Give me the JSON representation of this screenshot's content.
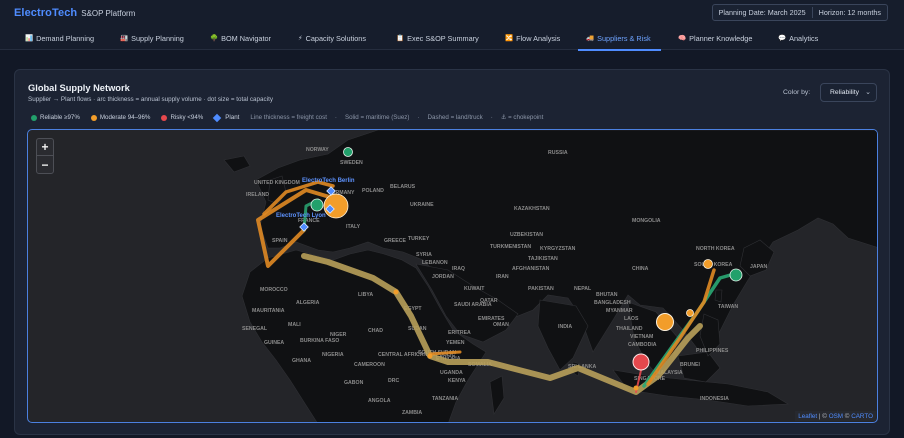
{
  "header": {
    "brand": "ElectroTech",
    "app_name": "S&OP Platform",
    "planning_date": "Planning Date: March 2025",
    "horizon": "Horizon: 12 months"
  },
  "tabs": [
    {
      "label": "Demand Planning",
      "icon": "chart-icon"
    },
    {
      "label": "Supply Planning",
      "icon": "factory-icon"
    },
    {
      "label": "BOM Navigator",
      "icon": "tree-icon"
    },
    {
      "label": "Capacity Solutions",
      "icon": "bolt-icon"
    },
    {
      "label": "Exec S&OP Summary",
      "icon": "clipboard-icon"
    },
    {
      "label": "Flow Analysis",
      "icon": "flow-icon"
    },
    {
      "label": "Suppliers & Risk",
      "icon": "truck-icon",
      "active": true
    },
    {
      "label": "Planner Knowledge",
      "icon": "brain-icon"
    },
    {
      "label": "Analytics",
      "icon": "speech-icon"
    }
  ],
  "panel": {
    "title": "Global Supply Network",
    "subtitle": "Supplier → Plant flows  ·  arc thickness = annual supply volume  ·  dot size = total capacity",
    "color_by_label": "Color by:",
    "color_by_value": "Reliability"
  },
  "legend": {
    "reliable": "Reliable ≥97%",
    "moderate": "Moderate 94–96%",
    "risky": "Risky <94%",
    "plant": "Plant",
    "note_thickness": "Line thickness = freight cost",
    "note_solid": "Solid = maritime (Suez)",
    "note_dashed": "Dashed = land/truck",
    "note_chokepoint": "⚓ = chokepoint",
    "colors": {
      "reliable": "#22a06b",
      "moderate": "#f29d2a",
      "risky": "#e5484d",
      "plant": "#4f8cff"
    }
  },
  "map": {
    "zoom_in": "+",
    "zoom_out": "−",
    "plants": [
      "ElectroTech Berlin",
      "ElectroTech Lyon"
    ],
    "attribution": {
      "leaflet": "Leaflet",
      "sep1": " | © ",
      "osm": "OSM",
      "sep2": " © ",
      "carto": "CARTO"
    },
    "labels": [
      "NORWAY",
      "MOROCCO",
      "ALGERIA",
      "LIBYA",
      "EGYPT",
      "SAUDI ARABIA",
      "YEMEN",
      "OMAN",
      "IRAN",
      "IRAQ",
      "SYRIA",
      "TURKEY",
      "UKRAINE",
      "KAZAKHSTAN",
      "MONGOLIA",
      "CHINA",
      "PAKISTAN",
      "INDIA",
      "MYANMAR",
      "THAILAND",
      "VIETNAM",
      "PHILIPPINES",
      "MALAYSIA",
      "INDONESIA",
      "JAPAN",
      "NORTH KOREA",
      "SOUTH KOREA",
      "MALI",
      "NIGER",
      "CHAD",
      "SUDAN",
      "NIGERIA",
      "ETHIOPIA",
      "KENYA",
      "DRC",
      "TANZANIA",
      "ANGOLA",
      "ZAMBIA",
      "MAURITANIA",
      "SENEGAL",
      "GHANA",
      "CAMEROON",
      "GABON",
      "SOMALIA",
      "RUSSIA",
      "POLAND",
      "FRANCE",
      "SPAIN",
      "UNITED KINGDOM",
      "BELARUS",
      "SWEDEN",
      "AFGHANISTAN",
      "TURKMENISTAN",
      "UZBEKISTAN",
      "NEPAL",
      "BANGLADESH",
      "SRI LANKA",
      "LAOS",
      "CAMBODIA",
      "SINGAPORE",
      "KYRGYZSTAN",
      "CENTRAL AFRICAN REPUBLIC",
      "UGANDA",
      "EMIRATES",
      "GREECE",
      "ITALY",
      "GERMANY",
      "IRELAND",
      "BURKINA FASO",
      "GUINEA",
      "SOUTH SUDAN",
      "ERITREA",
      "QATAR",
      "JORDAN",
      "LEBANON",
      "TAJIKISTAN",
      "BHUTAN",
      "TAIWAN",
      "BRUNEI",
      "KUWAIT"
    ]
  }
}
